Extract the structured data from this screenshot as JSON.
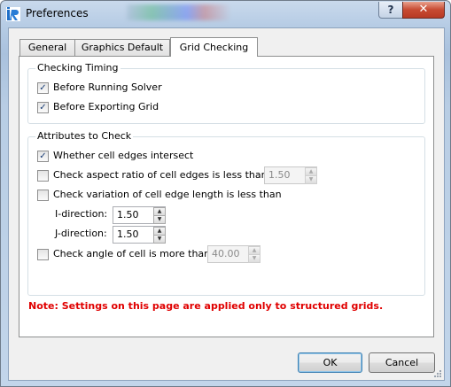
{
  "window": {
    "title": "Preferences",
    "help_label": "?",
    "close_label": "✕",
    "app_icon": "iric-app-icon"
  },
  "tabs": [
    {
      "label": "General"
    },
    {
      "label": "Graphics Default"
    },
    {
      "label": "Grid Checking",
      "active": true
    }
  ],
  "checking_timing": {
    "title": "Checking Timing",
    "items": [
      {
        "label": "Before Running Solver",
        "checked": true
      },
      {
        "label": "Before Exporting Grid",
        "checked": true
      }
    ]
  },
  "attributes": {
    "title": "Attributes to Check",
    "intersect": {
      "label": "Whether cell edges intersect",
      "checked": true
    },
    "aspect": {
      "label": "Check aspect ratio of cell edges is less than",
      "checked": false,
      "value": "1.50"
    },
    "variation": {
      "label": "Check variation of cell edge length is less than",
      "checked": false,
      "i_label": "I-direction:",
      "i_value": "1.50",
      "j_label": "J-direction:",
      "j_value": "1.50"
    },
    "angle": {
      "label": "Check angle of cell is more than",
      "checked": false,
      "value": "40.00"
    }
  },
  "note": "Note: Settings on this page are applied only to structured grids.",
  "buttons": {
    "ok": "OK",
    "cancel": "Cancel"
  },
  "colors": {
    "note": "#e00000",
    "checkmark": "#1c3f77",
    "close_button": "#c74a32"
  }
}
